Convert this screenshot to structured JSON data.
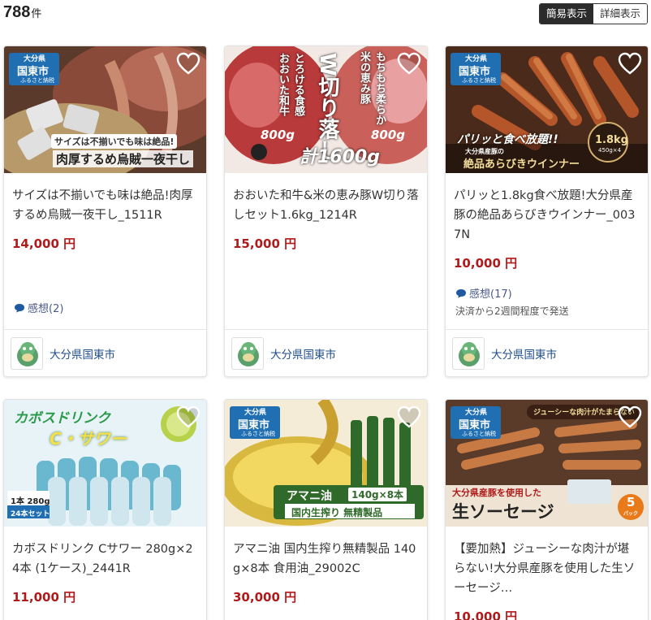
{
  "header": {
    "count": "788",
    "count_unit": "件",
    "view_simple": "簡易表示",
    "view_detail": "詳細表示"
  },
  "products": [
    {
      "title": "サイズは不揃いでも味は絶品!肉厚するめ烏賊一夜干し_1511R",
      "price": "14,000 円",
      "reviews": "感想(2)",
      "municipality": "大分県国東市",
      "img": {
        "badge_pref": "大分県",
        "badge_city": "国東市",
        "badge_sub": "ふるさと納税",
        "caption1": "サイズは不揃いでも味は絶品!",
        "caption2": "肉厚するめ烏賊一夜干し"
      }
    },
    {
      "title": "おおいた和牛&米の恵み豚W切り落しセット1.6kg_1214R",
      "price": "15,000 円",
      "municipality": "大分県国東市",
      "img": {
        "text_w": "W切り落し",
        "text_left": "とろける食感 おおいた和牛",
        "text_right": "もちもち柔らか 米の恵み豚",
        "g_left": "800g",
        "g_right": "800g",
        "total": "計1600g"
      }
    },
    {
      "title": "パリッと1.8kg食べ放題!大分県産豚の絶品あらびきウインナー_0037N",
      "price": "10,000 円",
      "reviews": "感想(17)",
      "shipping": "決済から2週間程度で発送",
      "municipality": "大分県国東市",
      "img": {
        "badge_pref": "大分県",
        "badge_city": "国東市",
        "badge_sub": "ふるさと納税",
        "caption1": "パリッと食べ放題!!",
        "caption2": "絶品あらびきウインナー",
        "sub": "大分県産豚の",
        "weight": "1.8kg",
        "weight_sub": "450g×4"
      }
    },
    {
      "title": "カボスドリンク Cサワー 280g×24本 (1ケース)_2441R",
      "price": "11,000 円",
      "img": {
        "headline1": "カボスドリンク",
        "headline2": "C・サワー",
        "note1": "1本 280g",
        "note2": "24本セット"
      }
    },
    {
      "title": "アマニ油 国内生搾り無精製品 140g×8本 食用油_29002C",
      "price": "30,000 円",
      "img": {
        "badge_pref": "大分県",
        "badge_city": "国東市",
        "badge_sub": "ふるさと納税",
        "name": "アマニ油",
        "qty": "140g×8本",
        "tagline": "国内生搾り 無精製品"
      }
    },
    {
      "title": "【要加熱】ジューシーな肉汁が堪らない!大分県産豚を使用した生ソーセージ…",
      "price": "10,000 円",
      "img": {
        "badge_pref": "大分県",
        "badge_city": "国東市",
        "badge_sub": "ふるさと納税",
        "banner": "ジューシーな肉汁がたまらない",
        "caption1": "大分県産豚を使用した",
        "caption2": "生ソーセージ",
        "pack_num": "5",
        "pack_unit": "パック"
      }
    }
  ]
}
